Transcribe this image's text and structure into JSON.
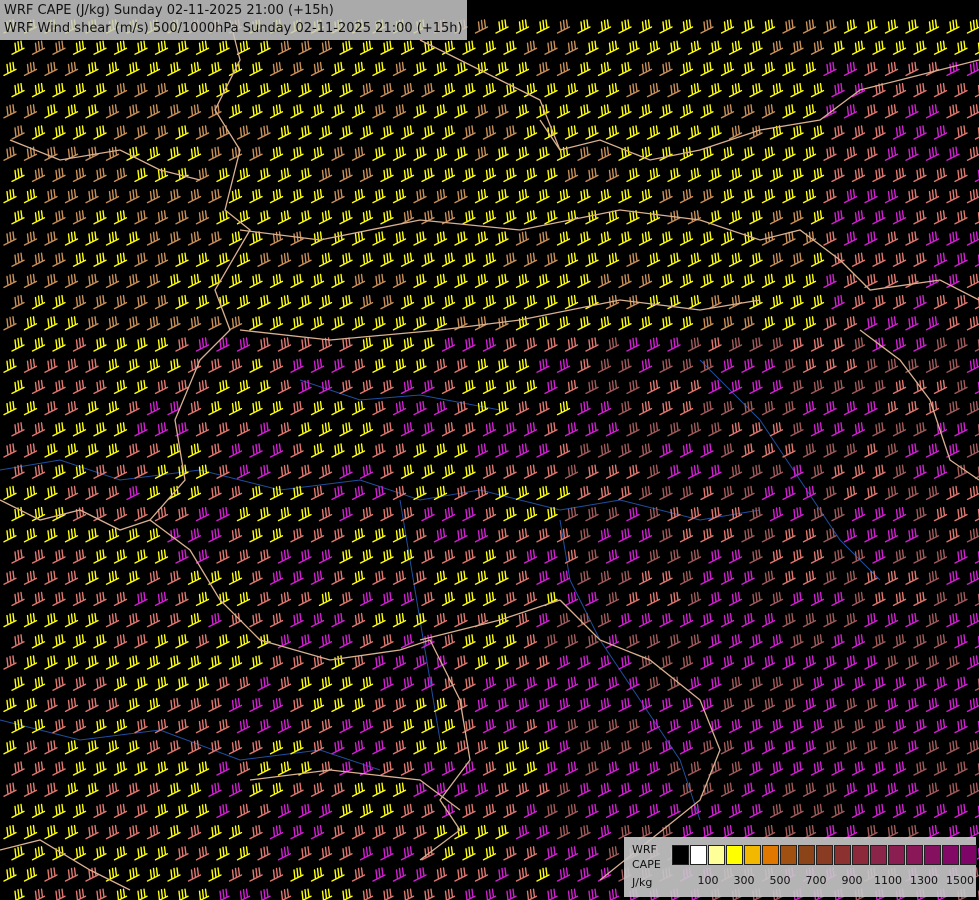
{
  "header": {
    "line1": "WRF CAPE (J/kg) Sunday 02-11-2025 21:00 (+15h)",
    "line2": "WRF Wind shear (m/s) 500/1000hPa Sunday 02-11-2025 21:00 (+15h)"
  },
  "map": {
    "background": "#000000",
    "border_color": "#d9b090",
    "river_color": "#1e4fa0",
    "wind_barb_icon": "wind-barb-icon"
  },
  "legend": {
    "line1": "WRF",
    "line2": "CAPE",
    "unit": "J/kg",
    "ticks": [
      "100",
      "300",
      "500",
      "700",
      "900",
      "1100",
      "1300",
      "1500"
    ],
    "colors": [
      "#000000",
      "#ffffff",
      "#ffff9a",
      "#ffff00",
      "#f2b800",
      "#e07800",
      "#a05010",
      "#8a4418",
      "#8a3c22",
      "#8c3030",
      "#8c2a3c",
      "#8a2448",
      "#8a1e50",
      "#8a1858",
      "#861060",
      "#820a66",
      "#7e0468"
    ]
  }
}
